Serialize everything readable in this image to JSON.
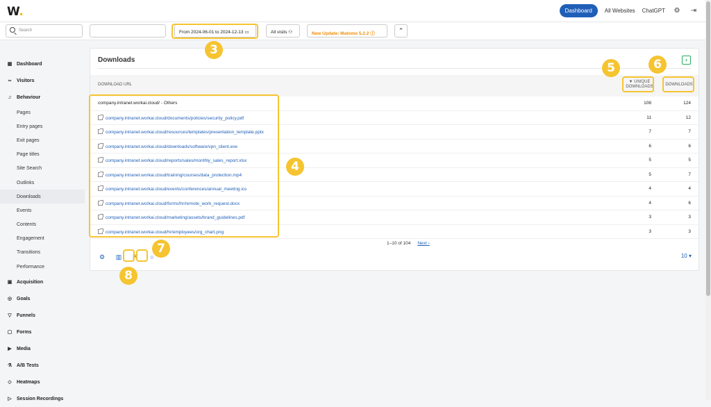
{
  "app": {
    "logo": "W",
    "logo_dot": "."
  },
  "topnav": {
    "dashboard": "Dashboard",
    "all_websites": "All Websites",
    "chatgpt": "ChatGPT",
    "settings_icon": "gear-icon",
    "logout_icon": "logout-icon"
  },
  "toolbar": {
    "search_placeholder": "Search",
    "date_range": "From 2024-06-01 to 2024-12-13",
    "segment": "All visits",
    "update": "New Update: Matomo 5.2.2",
    "collapse_icon": "chevrons-up-icon"
  },
  "sidebar": {
    "sections": [
      {
        "label": "Dashboard",
        "icon": "grid-icon"
      },
      {
        "label": "Visitors",
        "icon": "infinity-icon"
      },
      {
        "label": "Behaviour",
        "icon": "bell-icon"
      }
    ],
    "behaviour_items": [
      "Pages",
      "Entry pages",
      "Exit pages",
      "Page titles",
      "Site Search",
      "Outlinks",
      "Downloads",
      "Events",
      "Contents",
      "Engagement",
      "Transitions",
      "Performance"
    ],
    "active": "Downloads",
    "more_sections": [
      {
        "label": "Acquisition",
        "icon": "briefcase-icon"
      },
      {
        "label": "Goals",
        "icon": "target-icon"
      },
      {
        "label": "Funnels",
        "icon": "funnel-icon"
      },
      {
        "label": "Forms",
        "icon": "clipboard-icon"
      },
      {
        "label": "Media",
        "icon": "media-icon"
      },
      {
        "label": "A/B Tests",
        "icon": "flask-icon"
      },
      {
        "label": "Heatmaps",
        "icon": "flame-icon"
      },
      {
        "label": "Session Recordings",
        "icon": "play-icon"
      }
    ]
  },
  "report": {
    "title": "Downloads",
    "col_url": "DOWNLOAD URL",
    "col_unique_1": "UNIQUE",
    "col_unique_2": "DOWNLOADS",
    "col_downloads": "DOWNLOADS",
    "rows": [
      {
        "url": "company.intranet.workai.cloud/ - Others",
        "unique": "108",
        "downloads": "124",
        "link": false
      },
      {
        "url": "company.intranet.workai.cloud/documents/policies/security_policy.pdf",
        "unique": "11",
        "downloads": "12",
        "link": true
      },
      {
        "url": "company.intranet.workai.cloud/resources/templates/presentation_template.pptx",
        "unique": "7",
        "downloads": "7",
        "link": true
      },
      {
        "url": "company.intranet.workai.cloud/downloads/software/vpn_client.exe",
        "unique": "6",
        "downloads": "6",
        "link": true
      },
      {
        "url": "company.intranet.workai.cloud/reports/sales/monthly_sales_report.xlsx",
        "unique": "5",
        "downloads": "5",
        "link": true
      },
      {
        "url": "company.intranet.workai.cloud/training/courses/data_protection.mp4",
        "unique": "5",
        "downloads": "7",
        "link": true
      },
      {
        "url": "company.intranet.workai.cloud/events/conferences/annual_meeting.ics",
        "unique": "4",
        "downloads": "4",
        "link": true
      },
      {
        "url": "company.intranet.workai.cloud/forms/hr/remote_work_request.docx",
        "unique": "4",
        "downloads": "6",
        "link": true
      },
      {
        "url": "company.intranet.workai.cloud/marketing/assets/brand_guidelines.pdf",
        "unique": "3",
        "downloads": "3",
        "link": true
      },
      {
        "url": "company.intranet.workai.cloud/hr/employees/org_chart.png",
        "unique": "3",
        "downloads": "3",
        "link": true
      }
    ],
    "pagination": "1–10 of 104",
    "next": "Next ›",
    "limit": "10 ▾"
  },
  "markers": [
    "3",
    "4",
    "5",
    "6",
    "7",
    "8"
  ],
  "colors": {
    "accent": "#1f5fb8",
    "callout": "#f5c430",
    "update": "#f28c00"
  }
}
